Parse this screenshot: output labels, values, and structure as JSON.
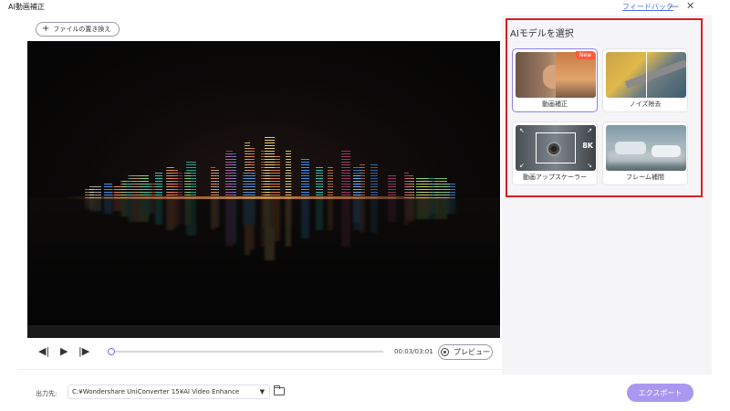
{
  "window": {
    "title": "AI動画補正",
    "feedback_link": "フィードバック",
    "minimize_glyph": "—",
    "close_glyph": "✕"
  },
  "toolbar": {
    "replace_file_label": "ファイルの置き換え"
  },
  "player": {
    "timecode": "00:03/03:01",
    "preview_label": "プレビュー",
    "progress_fraction": 0.0
  },
  "output": {
    "label": "出力先:",
    "path": "C:¥Wondershare UniConverter 15¥AI Video Enhance",
    "export_label": "エクスポート"
  },
  "model_panel": {
    "title": "AIモデルを選択",
    "models": [
      {
        "label": "動画補正",
        "badge": "New",
        "selected": true,
        "icon": "video-enhance-thumbnail"
      },
      {
        "label": "ノイズ除去",
        "selected": false,
        "icon": "noise-removal-thumbnail"
      },
      {
        "label": "動画アップスケーラー",
        "selected": false,
        "icon": "upscaler-thumbnail",
        "thumb_text": "8K"
      },
      {
        "label": "フレーム補間",
        "selected": false,
        "icon": "frame-interpolation-thumbnail"
      }
    ]
  },
  "colors": {
    "accent": "#8d7ff2",
    "export_button": "#a898f0",
    "highlight_border": "#d81f26",
    "new_badge": "#ff5a3c"
  }
}
